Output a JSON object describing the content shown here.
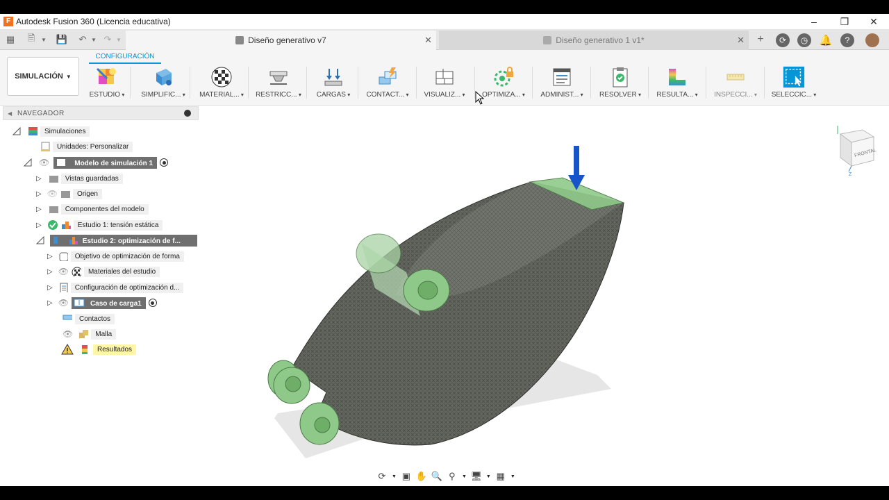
{
  "window": {
    "title": "Autodesk Fusion 360 (Licencia educativa)",
    "logo_letter": "F"
  },
  "tabs": {
    "active": "Diseño generativo v7",
    "inactive": "Diseño generativo 1 v1*"
  },
  "toolbar": {
    "workspace": "SIMULACIÓN",
    "config_tab": "CONFIGURACIÓN",
    "tools": [
      {
        "label": "ESTUDIO",
        "icon": "study-icon"
      },
      {
        "label": "SIMPLIFIC...",
        "icon": "simplify-icon"
      },
      {
        "label": "MATERIAL...",
        "icon": "materials-icon"
      },
      {
        "label": "RESTRICC...",
        "icon": "constraints-icon"
      },
      {
        "label": "CARGAS",
        "icon": "loads-icon"
      },
      {
        "label": "CONTACT...",
        "icon": "contacts-icon"
      },
      {
        "label": "VISUALIZ...",
        "icon": "display-icon"
      },
      {
        "label": "OPTIMIZA...",
        "icon": "optimization-icon"
      },
      {
        "label": "ADMINIST...",
        "icon": "manage-icon"
      },
      {
        "label": "RESOLVER",
        "icon": "solve-icon"
      },
      {
        "label": "RESULTA...",
        "icon": "results-icon"
      },
      {
        "label": "INSPECCI...",
        "icon": "inspect-icon"
      },
      {
        "label": "SELECCIC...",
        "icon": "select-icon"
      }
    ]
  },
  "browser": {
    "title": "NAVEGADOR",
    "items": {
      "simulations": "Simulaciones",
      "units": "Unidades: Personalizar",
      "model": "Modelo de simulación 1",
      "named_views": "Vistas guardadas",
      "origin": "Origen",
      "components": "Componentes del modelo",
      "study1": "Estudio 1: tensión estática",
      "study2": "Estudio 2: optimización de f...",
      "objective": "Objetivo de optimización de forma",
      "study_materials": "Materiales del estudio",
      "opt_config": "Configuración de optimización d...",
      "load_case": "Caso de carga1",
      "contacts": "Contactos",
      "mesh": "Malla",
      "results": "Resultados"
    }
  },
  "viewcube": {
    "face": "FRONTAL"
  },
  "colors": {
    "accent": "#0696d7",
    "highlight": "#6f6f6f",
    "mesh": "#5e625a",
    "preserve": "#8fc98a",
    "load_arrow": "#1555c9"
  }
}
